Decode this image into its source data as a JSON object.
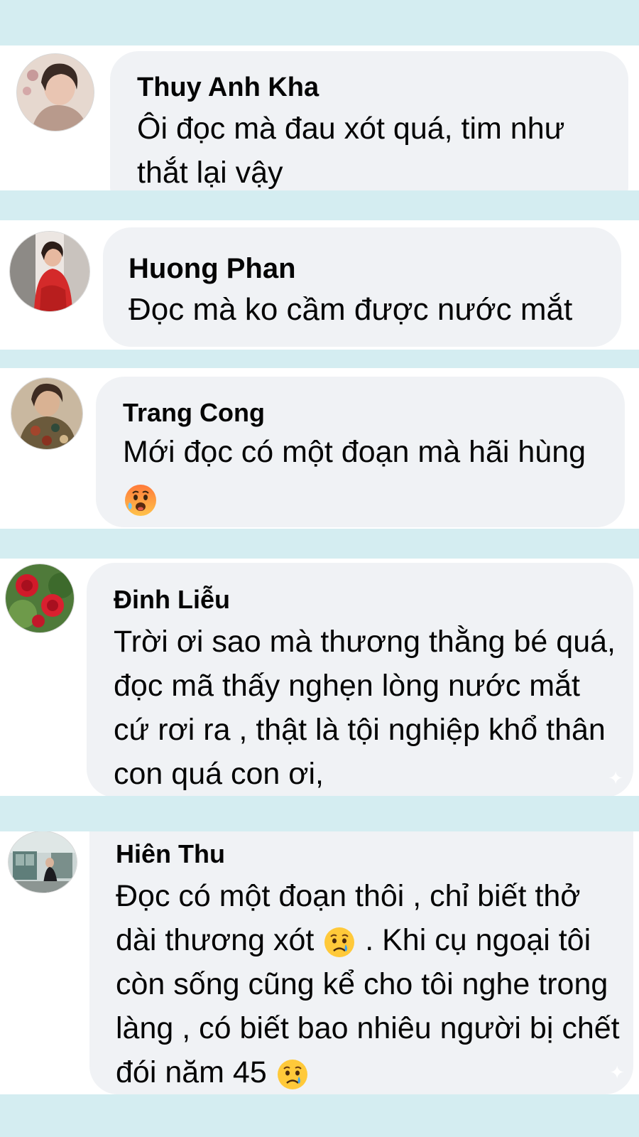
{
  "comments": [
    {
      "author": "Thuy Anh Kha",
      "text": "Ôi đọc mà đau xót quá, tim như thắt lại vậy"
    },
    {
      "author": "Huong Phan",
      "text": "Đọc mà ko cầm được nước mắt"
    },
    {
      "author": "Trang Cong",
      "text": "Mới đọc có một đoạn mà hãi hùng",
      "emoji": "hot-sweat-face-emoji"
    },
    {
      "author": "Đinh Liễu",
      "text": "Trời ơi sao mà thương thằng bé quá, đọc mã thấy nghẹn lòng nước mắt cứ rơi ra , thật là tội nghiệp khổ thân con quá con ơi,"
    },
    {
      "author": "Hiên Thu",
      "text_part1": "Đọc có một đoạn thôi , chỉ biết thở dài thương xót",
      "text_part2": ". Khi cụ ngoại tôi còn sống cũng kể cho tôi nghe trong làng , có biết bao nhiêu người bị chết đói năm 45",
      "emoji": "crying-face-emoji"
    }
  ],
  "colors": {
    "separator": "#d4edf1",
    "bubble": "#f0f2f5",
    "text": "#050505"
  }
}
